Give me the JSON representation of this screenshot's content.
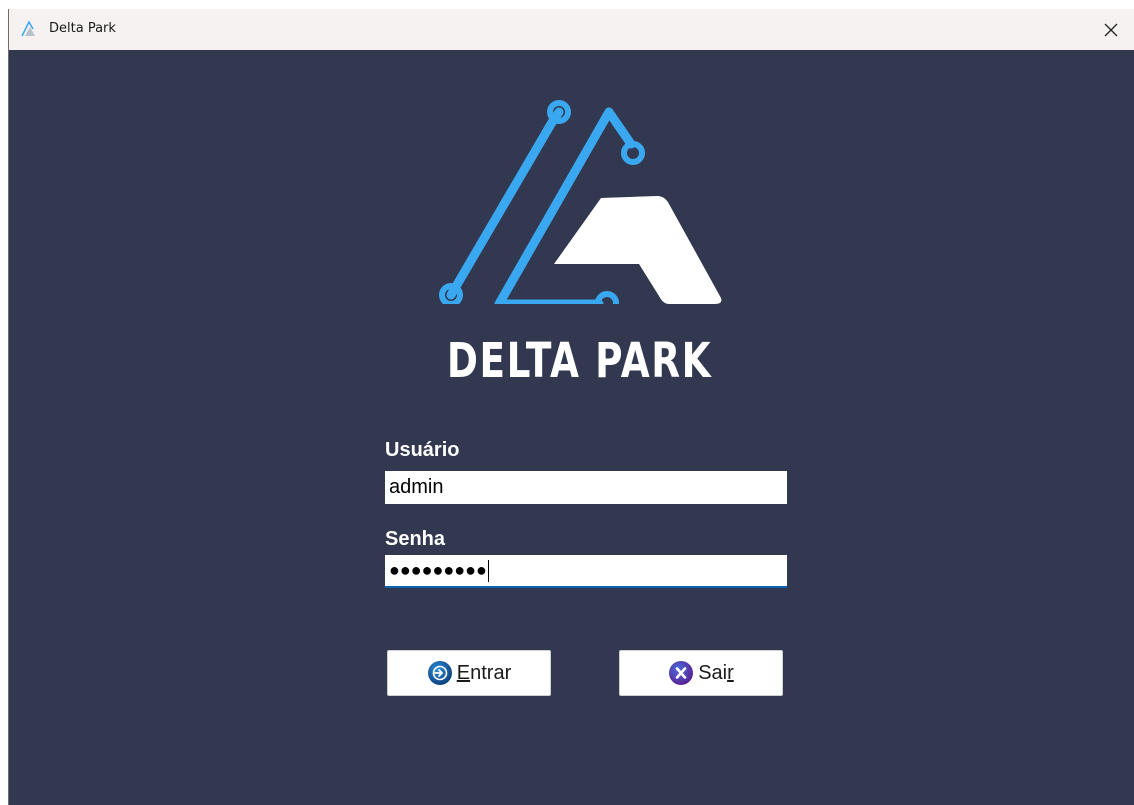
{
  "window": {
    "title": "Delta Park",
    "close_glyph": "✕"
  },
  "brand": {
    "name": "DELTA PARK",
    "accent_color": "#3aa8f0",
    "background_color": "#313850"
  },
  "login": {
    "username_label": "Usuário",
    "username_value": "admin",
    "password_label": "Senha",
    "password_mask": "●●●●●●●●●"
  },
  "buttons": {
    "enter": {
      "mnemonic": "E",
      "rest": "ntrar",
      "icon": "login-arrow-icon"
    },
    "exit": {
      "before": "Sai",
      "mnemonic": "r",
      "icon": "close-x-icon"
    }
  }
}
